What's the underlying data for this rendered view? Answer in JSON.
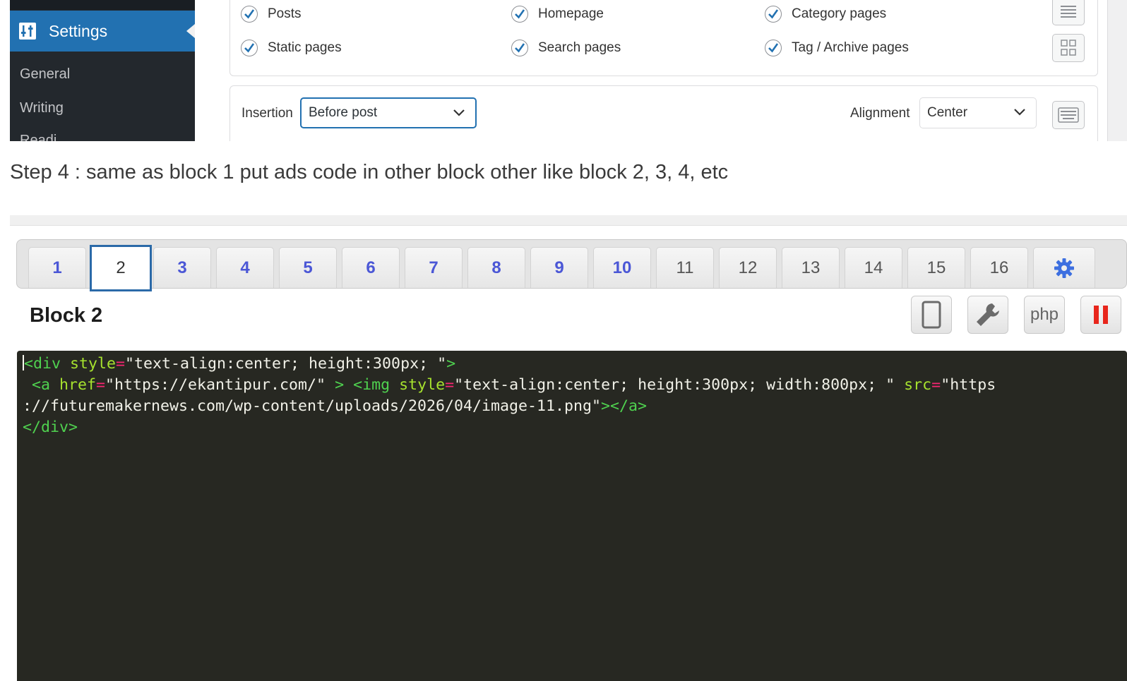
{
  "settings_screen": {
    "sidebar": {
      "active_item": "Settings",
      "sub_items": [
        "General",
        "Writing",
        "Readi"
      ]
    },
    "checkboxes": [
      {
        "label": "Posts",
        "checked": true
      },
      {
        "label": "Homepage",
        "checked": true
      },
      {
        "label": "Category pages",
        "checked": true
      },
      {
        "label": "Static pages",
        "checked": true
      },
      {
        "label": "Search pages",
        "checked": true
      },
      {
        "label": "Tag / Archive pages",
        "checked": true
      }
    ],
    "insertion": {
      "label": "Insertion",
      "value": "Before post"
    },
    "alignment": {
      "label": "Alignment",
      "value": "Center"
    },
    "colors": {
      "sidebar_bg": "#23282d",
      "accent": "#2271b1"
    }
  },
  "step_text": "Step 4 : same as block 1 put ads code in other block other like block 2, 3, 4, etc",
  "block_editor": {
    "tabs": [
      "1",
      "2",
      "3",
      "4",
      "5",
      "6",
      "7",
      "8",
      "9",
      "10",
      "11",
      "12",
      "13",
      "14",
      "15",
      "16"
    ],
    "active_tab": "2",
    "settings_tab_icon": "gear-icon",
    "block_title": "Block 2",
    "tool_buttons": [
      {
        "icon": "tablet-icon"
      },
      {
        "icon": "wrench-icon"
      },
      {
        "label": "php"
      },
      {
        "icon": "pause-icon"
      }
    ],
    "code": {
      "l1_tag_open": "<div",
      "l1_attr": " style",
      "l1_eq": "=",
      "l1_val": "\"text-align:center; height:300px; \"",
      "l1_close": ">",
      "l2_tag_open": " <a",
      "l2_attr1": " href",
      "l2_eq1": "=",
      "l2_val1": "\"https://ekantipur.com/\"",
      "l2_close1": " >",
      "l2_tag2": " <img",
      "l2_attr2": " style",
      "l2_eq2": "=",
      "l2_val2": "\"text-align:center; height:300px; width:800px; \"",
      "l2_attr3": " src",
      "l2_eq3": "=",
      "l2_val3": "\"https",
      "l3_val": "://futuremakernews.com/wp-content/uploads/2026/04/image-11.png\"",
      "l3_close": "></a>",
      "l4": "</div>"
    },
    "colors": {
      "editor_bg": "#272822",
      "tag": "#4fd14f",
      "attr": "#a6e22e",
      "active_tab_border": "#2b6aa8"
    }
  }
}
